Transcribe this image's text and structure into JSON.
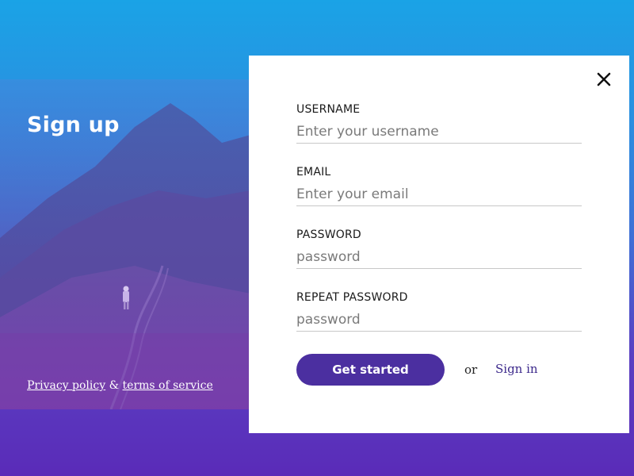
{
  "header": {
    "title": "Sign up"
  },
  "legal": {
    "privacy_label": "Privacy policy",
    "separator": "&",
    "terms_label": "terms of service"
  },
  "form": {
    "username": {
      "label": "USERNAME",
      "placeholder": "Enter your username",
      "value": ""
    },
    "email": {
      "label": "EMAIL",
      "placeholder": "Enter your email",
      "value": ""
    },
    "password": {
      "label": "PASSWORD",
      "placeholder": "password",
      "value": ""
    },
    "repeat_password": {
      "label": "REPEAT PASSWORD",
      "placeholder": "password",
      "value": ""
    },
    "submit_label": "Get started",
    "or_text": "or",
    "signin_label": "Sign in"
  },
  "icons": {
    "close": "close-icon"
  },
  "colors": {
    "accent": "#4b2fa0",
    "link": "#3d2a8c",
    "background_top": "#1aa3e6",
    "background_bottom": "#5a2bb8",
    "card": "#ffffff"
  }
}
